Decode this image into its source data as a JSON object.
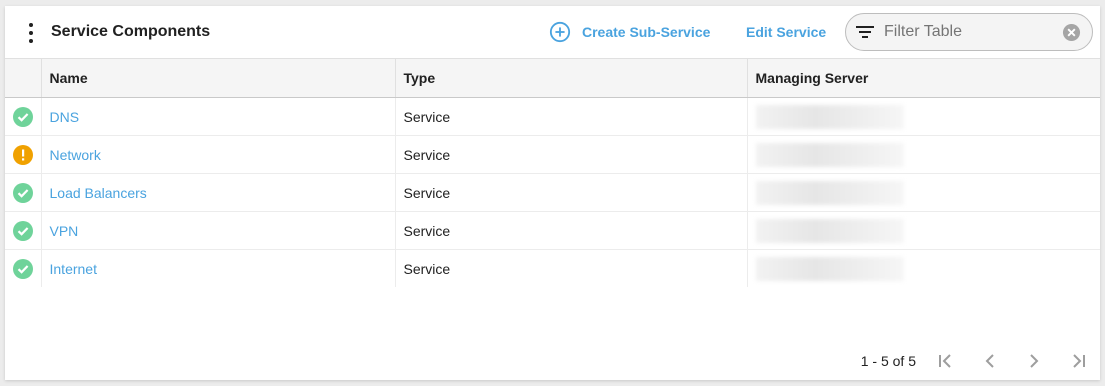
{
  "header": {
    "title": "Service Components",
    "create_label": "Create Sub-Service",
    "edit_label": "Edit Service",
    "filter_placeholder": "Filter Table"
  },
  "table": {
    "columns": [
      "Name",
      "Type",
      "Managing Server"
    ],
    "rows": [
      {
        "status": "ok",
        "name": "DNS",
        "type": "Service"
      },
      {
        "status": "warning",
        "name": "Network",
        "type": "Service"
      },
      {
        "status": "ok",
        "name": "Load Balancers",
        "type": "Service"
      },
      {
        "status": "ok",
        "name": "VPN",
        "type": "Service"
      },
      {
        "status": "ok",
        "name": "Internet",
        "type": "Service"
      }
    ]
  },
  "pagination": {
    "summary": "1 - 5 of 5"
  },
  "icons": {
    "menu": "more-vert-icon",
    "create": "add-circle-icon",
    "filter": "filter-list-icon",
    "clear": "clear-icon",
    "status_ok": "check-circle-icon",
    "status_warning": "warning-circle-icon",
    "first_page": "first-page-icon",
    "prev_page": "chevron-left-icon",
    "next_page": "chevron-right-icon",
    "last_page": "last-page-icon"
  },
  "colors": {
    "link": "#4aa3df",
    "ok": "#6fd39a",
    "warning": "#f0a100"
  }
}
